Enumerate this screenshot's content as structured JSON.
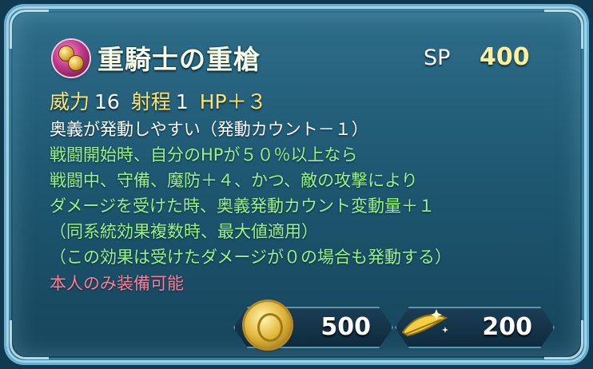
{
  "skill": {
    "name": "重騎士の重槍",
    "sp_label": "SP",
    "sp_value": "400",
    "stats": {
      "might_label": "威力",
      "might_value": "16",
      "range_label": "射程",
      "range_value": "1",
      "hp_bonus": "HP＋３"
    },
    "description": [
      "奥義が発動しやすい（発動カウント－１）",
      "戦闘開始時、自分のHPが５０％以上なら",
      "戦闘中、守備、魔防＋４、かつ、敵の攻撃により",
      "ダメージを受けた時、奥義発動カウント変動量＋１",
      "（同系統効果複数時、最大値適用）",
      "（この効果は受けたダメージが０の場合も発動する）"
    ],
    "restriction": "本人のみ装備可能"
  },
  "costs": {
    "medal_icon": "gold-medal-icon",
    "medal_value": "500",
    "feather_icon": "golden-feather-icon",
    "feather_value": "200"
  },
  "colors": {
    "title": "#f7ffe8",
    "stat_label": "#ffe36b",
    "effect_text": "#9df08a",
    "restriction_text": "#ff7a93",
    "sp_value": "#ffef9a"
  }
}
